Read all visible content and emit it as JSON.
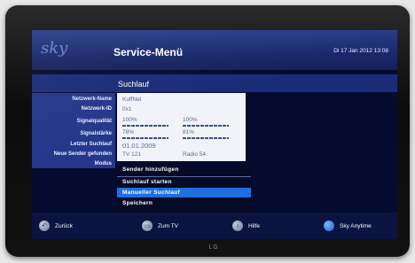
{
  "header": {
    "logo": "sky",
    "title": "Service-Menü",
    "datetime": "Di 17 Jan 2012  13:08"
  },
  "section": {
    "title": "Suchlauf"
  },
  "fields": [
    {
      "label": "Netzwerk-Name",
      "value": "KuffNet"
    },
    {
      "label": "Netzwerk-ID",
      "value": "0x1"
    },
    {
      "label": "Signalqualität",
      "value_left": "100%",
      "value_right": "100%"
    },
    {
      "label": "Signalstärke",
      "value_left": "78%",
      "value_right": "81%"
    },
    {
      "label": "Letzter Suchlauf",
      "value": "01.01.2009"
    },
    {
      "label": "Neue Sender gefunden",
      "value_tv": "TV  121",
      "value_radio": "Radio  54"
    },
    {
      "label": "Modus"
    }
  ],
  "menu": {
    "items": [
      {
        "label": "Sender hinzufügen",
        "selected": false
      },
      {
        "label": "Suchlauf starten",
        "selected": false
      },
      {
        "label": "Manueller Suchlauf",
        "selected": true
      },
      {
        "label": "Speichern",
        "selected": false
      }
    ]
  },
  "footer": {
    "back": "Zurück",
    "tv": "Zum TV",
    "help": "Hilfe",
    "anytime": "Sky Anytime",
    "help_icon": "i"
  },
  "tv_brand": "LG",
  "colors": {
    "header": "#1b2a6e",
    "label_column": "#25378a",
    "value_panel": "#f1f3f8",
    "selected_item": "#1f6fe0",
    "sky_anytime_button": "#1f5fd0"
  }
}
